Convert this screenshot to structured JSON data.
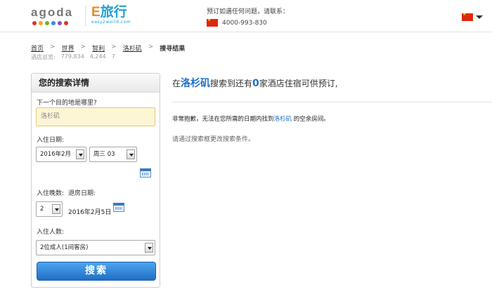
{
  "header": {
    "agoda_logo_text": "agoda",
    "agoda_dot_colors": [
      "#e0312a",
      "#f5a81c",
      "#6ab42c",
      "#2f8fd6",
      "#8a4fb7",
      "#e0312a"
    ],
    "partner_logo_main_e": "E",
    "partner_logo_main": "旅行",
    "partner_logo_sub": "easy2world.com",
    "contact_label": "预订如遇任何问题，请联系：",
    "contact_phone": "4000-993-830",
    "contact_flag_icon": "china-flag-icon",
    "language_flag_icon": "china-flag-icon"
  },
  "breadcrumb": {
    "items": [
      "首页",
      "世界",
      "智利",
      "洛杉矶"
    ],
    "current": "搜寻结果",
    "separator": ">",
    "counts_label": "酒店总览:",
    "counts": [
      "779,834",
      "4,244",
      "7"
    ]
  },
  "search_panel": {
    "title": "您的搜索详情",
    "destination_label": "下一个目的地是哪里?",
    "destination_value": "洛杉矶",
    "checkin_label": "入住日期:",
    "checkin_month": "2016年2月",
    "checkin_day": "周三 03",
    "nights_label": "入住晚数:",
    "checkout_label": "退房日期:",
    "nights_value": "2",
    "checkout_date": "2016年2月5日",
    "guests_label": "入住人数:",
    "guests_value": "2位成人(1间客房)",
    "search_button": "搜索"
  },
  "results": {
    "title_prefix": "在",
    "city": "洛杉矶",
    "title_middle": "搜索到还有",
    "count": "0",
    "title_suffix": "家酒店住宿可供预订,",
    "sorry_prefix": "非常抱歉，无法在您所需的日期内找到",
    "sorry_suffix": " 的空余房间。",
    "hint": "请通过搜索框更改搜索条件。"
  },
  "colors": {
    "accent_blue": "#1f6fc8",
    "input_highlight": "#fdf6d6",
    "button_top": "#4ea5ee",
    "button_bottom": "#1f6fc8"
  }
}
